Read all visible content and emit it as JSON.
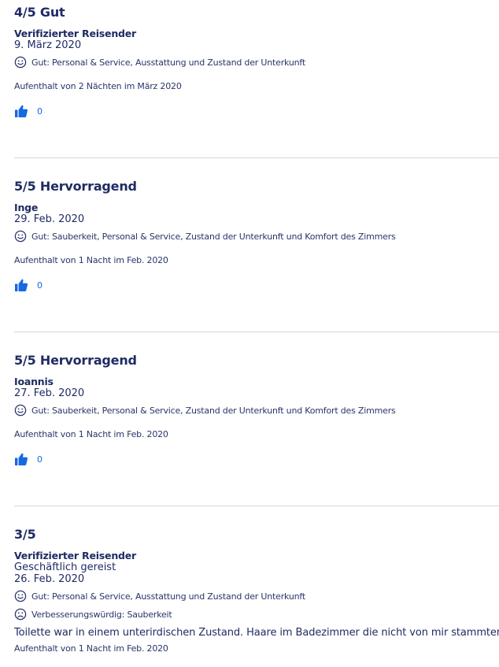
{
  "reviews": [
    {
      "rating": "4/5 Gut",
      "author": "Verifizierter Reisender",
      "date": "9. März 2020",
      "positive": "Gut: Personal & Service, Ausstattung und Zustand der Unterkunft",
      "stay": "Aufenthalt von 2 Nächten im März 2020",
      "helpful_count": "0"
    },
    {
      "rating": "5/5 Hervorragend",
      "author": "Inge",
      "date": "29. Feb. 2020",
      "positive": "Gut: Sauberkeit, Personal & Service, Zustand der Unterkunft und Komfort des Zimmers",
      "stay": "Aufenthalt von 1 Nacht im Feb. 2020",
      "helpful_count": "0"
    },
    {
      "rating": "5/5 Hervorragend",
      "author": "Ioannis",
      "date": "27. Feb. 2020",
      "positive": "Gut: Sauberkeit, Personal & Service, Zustand der Unterkunft und Komfort des Zimmers",
      "stay": "Aufenthalt von 1 Nacht im Feb. 2020",
      "helpful_count": "0"
    },
    {
      "rating": "3/5",
      "author": "Verifizierter Reisender",
      "trip_type": "Geschäftlich gereist",
      "date": "26. Feb. 2020",
      "positive": "Gut: Personal & Service, Ausstattung und Zustand der Unterkunft",
      "negative": "Verbesserungswürdig: Sauberkeit",
      "comment": "Toilette war in einem unterirdischen Zustand. Haare im Badezimmer die nicht von mir stammten.",
      "stay": "Aufenthalt von 1 Nacht im Feb. 2020"
    }
  ],
  "icons": {
    "positive": "smile-icon",
    "negative": "frown-icon",
    "helpful": "thumbs-up-icon"
  },
  "colors": {
    "text": "#1f2b63",
    "link": "#1668e3",
    "divider": "#d6d6dc"
  }
}
